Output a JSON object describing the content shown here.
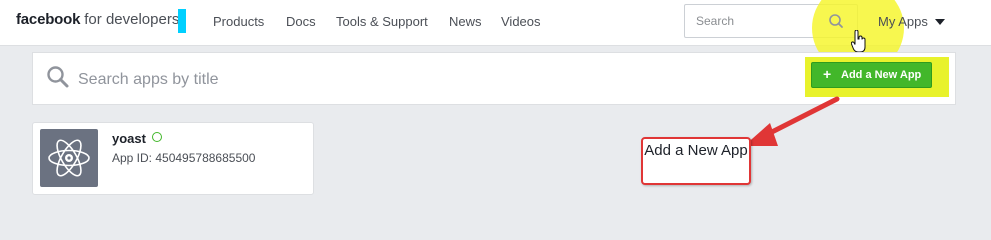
{
  "header": {
    "brand_bold": "facebook",
    "brand_sub": "for developers",
    "nav": [
      "Products",
      "Docs",
      "Tools & Support",
      "News",
      "Videos"
    ],
    "search_placeholder": "Search",
    "my_apps_label": "My Apps"
  },
  "toolbar": {
    "search_placeholder": "Search apps by title",
    "add_button_label": "Add a New App"
  },
  "apps": [
    {
      "name": "yoast",
      "app_id": "App ID: 450495788685500"
    }
  ],
  "annotation": {
    "callout_text": "Add a New App"
  },
  "colors": {
    "accent_green": "#42b72a",
    "callout_red": "#e03636",
    "highlight_yellow": "#f5f528",
    "cursor_cyan": "#00d0ff"
  }
}
